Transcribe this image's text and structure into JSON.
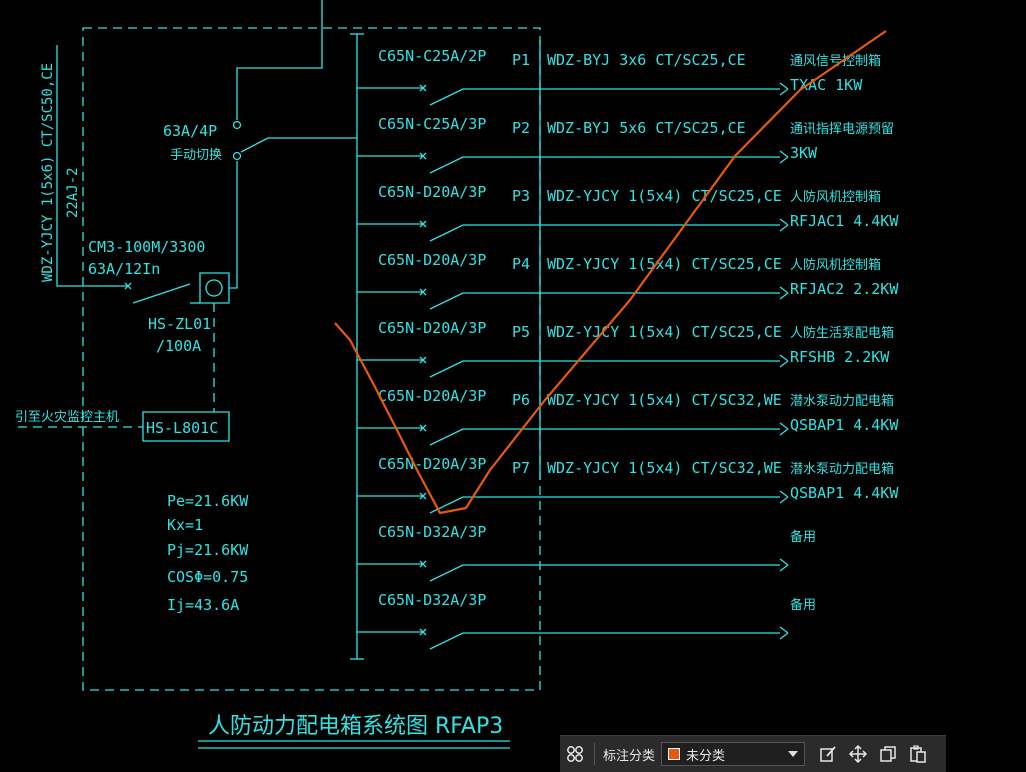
{
  "drawing": {
    "title": "人防动力配电箱系统图  RFAP3",
    "incoming_cable": "WDZ-YJCY 1(5x6) CT/SC50,CE",
    "incoming_source": "22AJ-2",
    "manual_switch": {
      "rating": "63A/4P",
      "label": "手动切换"
    },
    "main_breaker": {
      "model": "CM3-100M/3300",
      "rating": "63A/12In"
    },
    "meter": {
      "model": "HS-ZL01",
      "rating": "/100A"
    },
    "monitor": {
      "label": "引至火灾监控主机",
      "model": "HS-L801C"
    },
    "load_calc": {
      "pe": "Pe=21.6KW",
      "kx": "Kx=1",
      "pj": "Pj=21.6KW",
      "cos": "COSΦ=0.75",
      "ij": "Ij=43.6A"
    },
    "circuits": [
      {
        "breaker": "C65N-C25A/2P",
        "id": "P1",
        "cable": "WDZ-BYJ 3x6  CT/SC25,CE",
        "load": "通风信号控制箱",
        "detail": "TXAC  1KW"
      },
      {
        "breaker": "C65N-C25A/3P",
        "id": "P2",
        "cable": "WDZ-BYJ 5x6  CT/SC25,CE",
        "load": "通讯指挥电源预留",
        "detail": "3KW"
      },
      {
        "breaker": "C65N-D20A/3P",
        "id": "P3",
        "cable": "WDZ-YJCY 1(5x4) CT/SC25,CE",
        "load": "人防风机控制箱",
        "detail": "RFJAC1  4.4KW"
      },
      {
        "breaker": "C65N-D20A/3P",
        "id": "P4",
        "cable": "WDZ-YJCY 1(5x4) CT/SC25,CE",
        "load": "人防风机控制箱",
        "detail": "RFJAC2  2.2KW"
      },
      {
        "breaker": "C65N-D20A/3P",
        "id": "P5",
        "cable": "WDZ-YJCY 1(5x4) CT/SC25,CE",
        "load": "人防生活泵配电箱",
        "detail": "RFSHB  2.2KW"
      },
      {
        "breaker": "C65N-D20A/3P",
        "id": "P6",
        "cable": "WDZ-YJCY 1(5x4) CT/SC32,WE",
        "load": "潜水泵动力配电箱",
        "detail": "QSBAP1  4.4KW"
      },
      {
        "breaker": "C65N-D20A/3P",
        "id": "P7",
        "cable": "WDZ-YJCY 1(5x4) CT/SC32,WE",
        "load": "潜水泵动力配电箱",
        "detail": "QSBAP1  4.4KW"
      },
      {
        "breaker": "C65N-D32A/3P",
        "id": "",
        "cable": "",
        "load": "备用",
        "detail": ""
      },
      {
        "breaker": "C65N-D32A/3P",
        "id": "",
        "cable": "",
        "load": "备用",
        "detail": ""
      }
    ]
  },
  "toolbar": {
    "category_label": "标注分类",
    "category_value": "未分类",
    "category_color": "#e8590c",
    "icons": [
      "layout-icon",
      "edit-icon",
      "move-icon",
      "copy-icon",
      "paste-icon"
    ]
  },
  "colors": {
    "line": "#2fe3e3",
    "annotation_stroke": "#e8590c",
    "background": "#000000"
  }
}
